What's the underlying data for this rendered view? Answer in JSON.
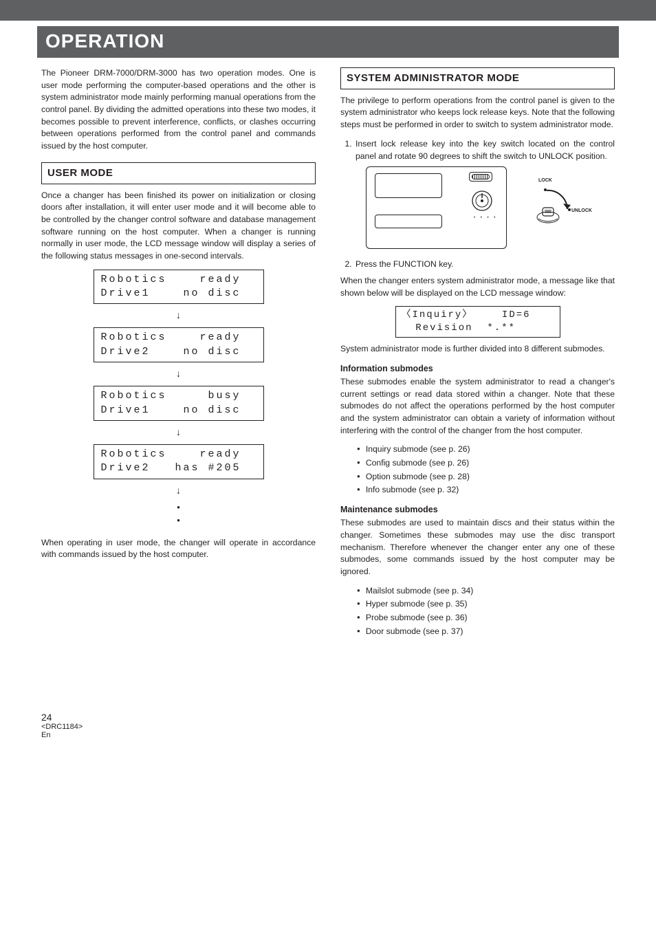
{
  "chapter": "OPERATION",
  "intro": "The Pioneer DRM-7000/DRM-3000 has two operation modes. One is user mode performing the computer-based operations and the other is system administrator mode mainly performing manual operations from the control panel. By dividing the admitted operations into these two modes, it becomes possible to prevent interference, conflicts, or clashes occurring between operations performed from the control panel and commands issued by the host computer.",
  "user_mode": {
    "heading": "USER MODE",
    "para": "Once a changer has been finished its power on initialization or closing doors after installation, it will enter user mode and it will become able to be controlled by the changer control software and database management software running on the host computer. When a changer is running normally in user mode, the LCD message window will display a series of the following status messages in one-second intervals.",
    "lcd": [
      "Robotics    ready\nDrive1    no disc",
      "Robotics    ready\nDrive2    no disc",
      "Robotics     busy\nDrive1    no disc",
      "Robotics    ready\nDrive2   has #205"
    ],
    "closing": "When operating in user mode, the changer will operate in accordance with commands issued by the host computer."
  },
  "sysadmin": {
    "heading": "SYSTEM ADMINISTRATOR MODE",
    "intro": "The privilege to perform operations from the control panel is given to the system administrator who keeps lock release keys. Note that the following steps must be performed in order to switch to system administrator mode.",
    "step1": "Insert lock release key into the key switch located on the control panel and rotate 90 degrees to shift the switch to UNLOCK position.",
    "step2": "Press the FUNCTION key.",
    "post": "When the changer enters system administrator mode, a message like that shown below will be displayed on the LCD message window:",
    "lcd": "〈Inquiry〉    ID=6\n  Revision  *.**",
    "after_lcd": "System administrator mode is further divided into 8 different submodes.",
    "info_head": "Information submodes",
    "info_para": "These submodes enable the system administrator to read a changer's current settings or read data stored within a changer. Note that these submodes do not affect the operations performed by the host computer and the system administrator can obtain a variety of information without interfering with the control of the changer from the host computer.",
    "info_list": [
      "Inquiry submode (see p. 26)",
      "Config submode (see p. 26)",
      "Option submode (see p. 28)",
      "Info submode (see p. 32)"
    ],
    "maint_head": "Maintenance submodes",
    "maint_para": "These submodes are used to maintain discs and their status within the changer. Sometimes these submodes may use the disc transport mechanism. Therefore whenever the changer enter any one of these submodes, some commands issued by the host computer may be ignored.",
    "maint_list": [
      "Mailslot submode (see p. 34)",
      "Hyper submode (see p. 35)",
      "Probe submode (see p. 36)",
      "Door submode (see p. 37)"
    ],
    "fig_labels": {
      "lock": "LOCK",
      "unlock": "UNLOCK"
    }
  },
  "footer": {
    "page": "24",
    "code": "<DRC1184>",
    "lang": "En"
  }
}
